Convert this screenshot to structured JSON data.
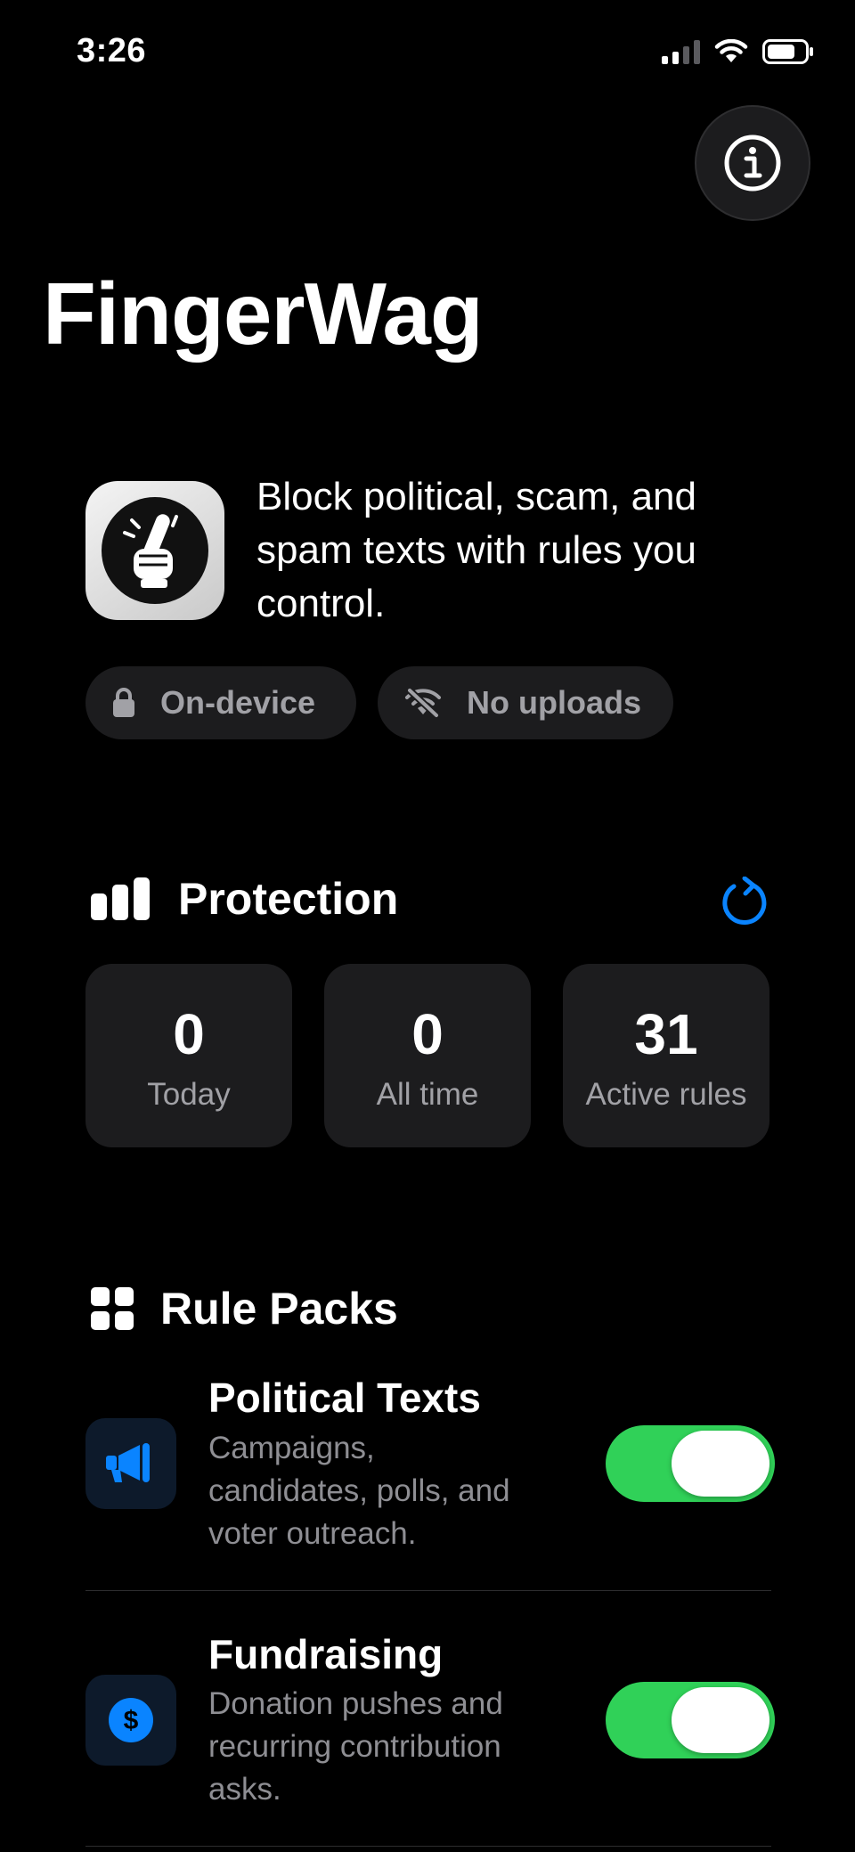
{
  "status_bar": {
    "time": "3:26"
  },
  "header": {
    "title": "FingerWag",
    "info_icon": "info-circle-icon"
  },
  "intro": {
    "tagline": "Block political, scam, and spam texts with rules you control.",
    "chips": [
      {
        "label": "On-device",
        "icon": "lock-icon"
      },
      {
        "label": "No uploads",
        "icon": "wifi-slash-icon"
      }
    ]
  },
  "protection": {
    "title": "Protection",
    "icon": "bar-chart-icon",
    "refresh_icon": "refresh-icon",
    "stats": [
      {
        "value": "0",
        "label": "Today"
      },
      {
        "value": "0",
        "label": "All time"
      },
      {
        "value": "31",
        "label": "Active rules"
      }
    ]
  },
  "rule_packs": {
    "title": "Rule Packs",
    "icon": "grid-icon",
    "items": [
      {
        "title": "Political Texts",
        "description": "Campaigns, candidates, polls, and voter outreach.",
        "icon": "megaphone-icon",
        "enabled": true
      },
      {
        "title": "Fundraising",
        "description": "Donation pushes and recurring contribution asks.",
        "icon": "dollar-circle-icon",
        "enabled": true
      }
    ]
  },
  "colors": {
    "background": "#000000",
    "card": "#1c1c1e",
    "accent_blue": "#0a84ff",
    "toggle_on": "#30d158",
    "secondary_text": "#8e8e93"
  }
}
